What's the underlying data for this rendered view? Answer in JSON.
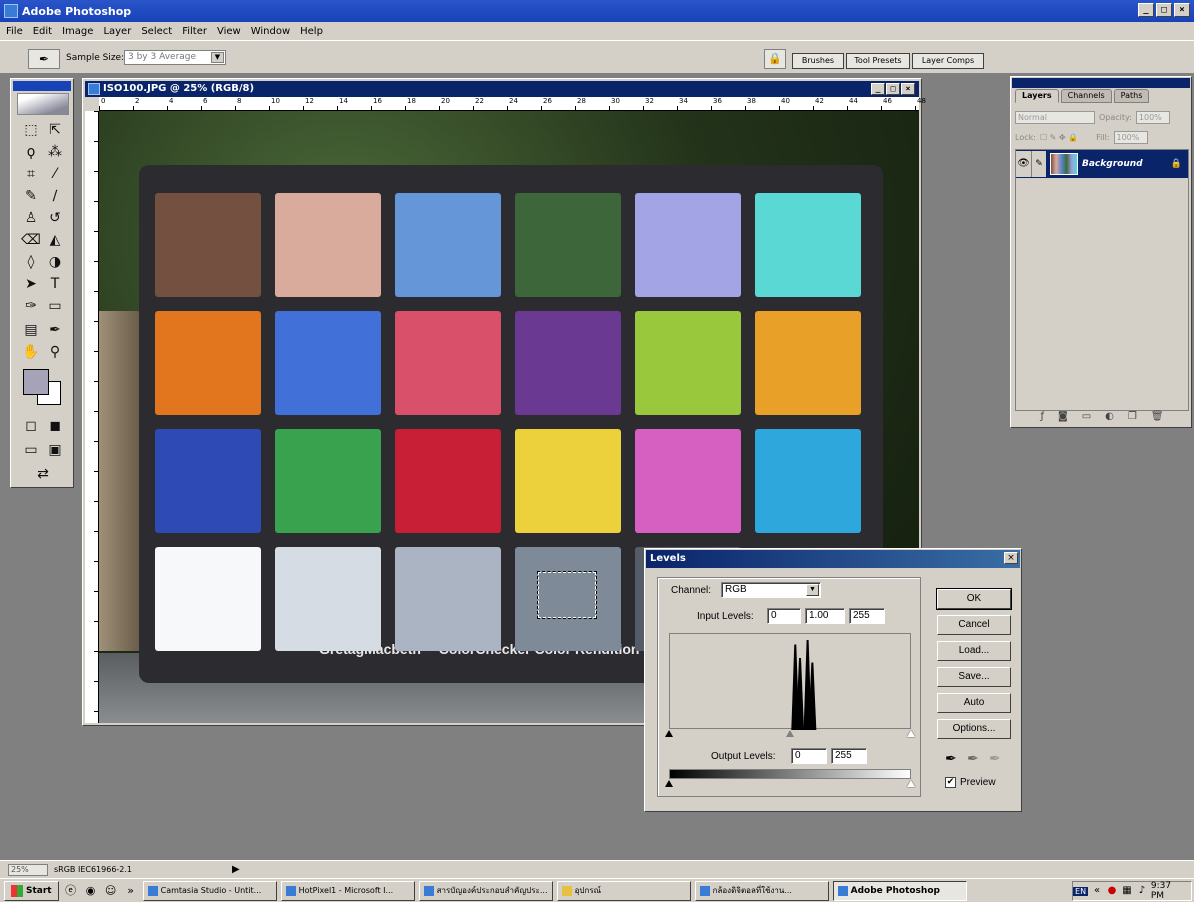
{
  "app": {
    "title": "Adobe Photoshop",
    "window_controls": [
      "_",
      "□",
      "×"
    ]
  },
  "menu": [
    "File",
    "Edit",
    "Image",
    "Layer",
    "Select",
    "Filter",
    "View",
    "Window",
    "Help"
  ],
  "options_bar": {
    "sample_size_label": "Sample Size:",
    "sample_size_value": "3 by 3 Average",
    "palette_well": [
      "Brushes",
      "Tool Presets",
      "Layer Comps"
    ]
  },
  "document": {
    "title": "ISO100.JPG @ 25% (RGB/8)",
    "ruler_labels": [
      "0",
      "2",
      "4",
      "6",
      "8",
      "10",
      "12",
      "14",
      "16",
      "18",
      "20",
      "22",
      "24",
      "26",
      "28",
      "30",
      "32",
      "34",
      "36",
      "38",
      "40",
      "42",
      "44",
      "46",
      "48"
    ],
    "chart_label": "GretagMacbeth™ ColorChecker Color Rendition Chart",
    "swatches": [
      [
        "#73503f",
        "#d8ab9c",
        "#6496d8",
        "#3d663a",
        "#a2a4e6",
        "#5ad8d4"
      ],
      [
        "#e2761e",
        "#4070d8",
        "#d8506a",
        "#6a3a92",
        "#9ac83c",
        "#e8a028"
      ],
      [
        "#2e4ab4",
        "#38a24e",
        "#c81e36",
        "#ecd03c",
        "#d660c2",
        "#2ea8dc"
      ],
      [
        "#f6f8fa",
        "#d6dce4",
        "#aab4c2",
        "#7e8a98",
        "#545c68",
        "#2a2e36"
      ]
    ]
  },
  "layers_panel": {
    "tabs": [
      "Layers",
      "Channels",
      "Paths"
    ],
    "blend_mode": "Normal",
    "opacity_label": "Opacity:",
    "opacity_value": "100%",
    "lock_label": "Lock:",
    "fill_label": "Fill:",
    "fill_value": "100%",
    "layer_name": "Background"
  },
  "levels_dialog": {
    "title": "Levels",
    "channel_label": "Channel:",
    "channel_value": "RGB",
    "input_levels_label": "Input Levels:",
    "input_black": "0",
    "input_gamma": "1.00",
    "input_white": "255",
    "output_levels_label": "Output Levels:",
    "output_black": "0",
    "output_white": "255",
    "buttons": [
      "OK",
      "Cancel",
      "Load...",
      "Save...",
      "Auto",
      "Options..."
    ],
    "preview_label": "Preview",
    "preview_checked": true,
    "histogram_peaks": [
      {
        "level": 132,
        "height": 0.95
      },
      {
        "level": 137,
        "height": 0.8
      },
      {
        "level": 145,
        "height": 1.0
      },
      {
        "level": 150,
        "height": 0.75
      }
    ]
  },
  "status_bar": {
    "zoom": "25%",
    "profile": "sRGB IEC61966-2.1"
  },
  "taskbar": {
    "start": "Start",
    "tasks": [
      "Camtasia Studio - Untit...",
      "HotPixel1 - Microsoft I...",
      "สารบัญองค์ประกอบสำคัญประ...",
      "อุปกรณ์",
      "กล้องดิจิตอลที่ใช้งาน...",
      "Adobe Photoshop"
    ],
    "lang": "EN",
    "clock": "9:37 PM"
  }
}
